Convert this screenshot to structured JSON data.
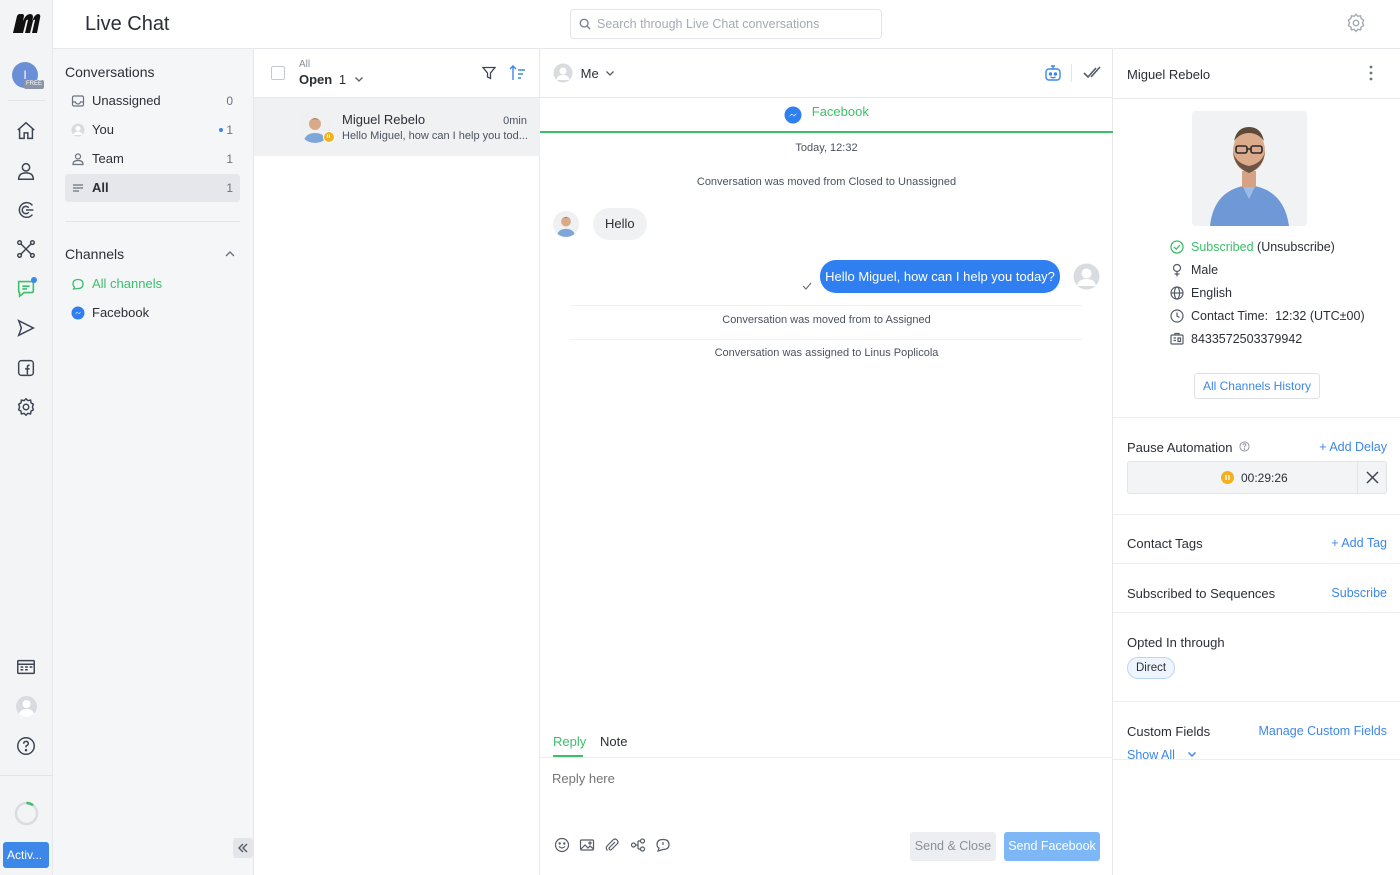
{
  "app": {
    "title": "Live Chat",
    "plan_badge": "FREE",
    "avatar_initial": "I"
  },
  "search": {
    "placeholder": "Search through Live Chat conversations"
  },
  "rail": {
    "active_label": "Activ..."
  },
  "nav": {
    "conversations_heading": "Conversations",
    "items": [
      {
        "label": "Unassigned",
        "count": "0"
      },
      {
        "label": "You",
        "count": "1"
      },
      {
        "label": "Team",
        "count": "1"
      },
      {
        "label": "All",
        "count": "1"
      }
    ],
    "channels_heading": "Channels",
    "channels": [
      {
        "label": "All channels"
      },
      {
        "label": "Facebook"
      }
    ]
  },
  "list": {
    "filter_caption": "All",
    "status_label": "Open",
    "status_count": "1",
    "conversation": {
      "name": "Miguel Rebelo",
      "time": "0min",
      "preview": "Hello Miguel, how can I help you tod..."
    }
  },
  "chat": {
    "assignee": "Me",
    "channel_tab": "Facebook",
    "date_label": "Today, 12:32",
    "system_messages": [
      "Conversation was moved from Closed to Unassigned",
      "Conversation was moved from to Assigned",
      "Conversation was assigned to Linus Poplicola"
    ],
    "incoming_message": "Hello",
    "outgoing_message": "Hello Miguel, how can I help you today?",
    "composer": {
      "tabs": [
        "Reply",
        "Note"
      ],
      "placeholder": "Reply here",
      "send_close_label": "Send & Close",
      "send_label": "Send Facebook"
    }
  },
  "contact": {
    "name": "Miguel Rebelo",
    "subscribed_label": "Subscribed",
    "unsubscribe_label": "(Unsubscribe)",
    "gender": "Male",
    "language": "English",
    "contact_time_label": "Contact Time:",
    "contact_time_value": "12:32 (UTC±00)",
    "id": "8433572503379942",
    "history_button": "All Channels History",
    "pause_automation_label": "Pause Automation",
    "add_delay_label": "+ Add Delay",
    "pause_timer": "00:29:26",
    "tags_label": "Contact Tags",
    "add_tag_label": "+ Add Tag",
    "sequences_label": "Subscribed to Sequences",
    "subscribe_label": "Subscribe",
    "opted_in_label": "Opted In through",
    "opted_in_value": "Direct",
    "custom_fields_label": "Custom Fields",
    "manage_fields_label": "Manage Custom Fields",
    "show_all_label": "Show All"
  },
  "colors": {
    "accent_blue": "#3d87e8",
    "bubble_blue": "#2f7ff0",
    "success_green": "#3cbf6a",
    "pause_orange": "#f2b01e",
    "send_disabled": "#7db7f5"
  }
}
